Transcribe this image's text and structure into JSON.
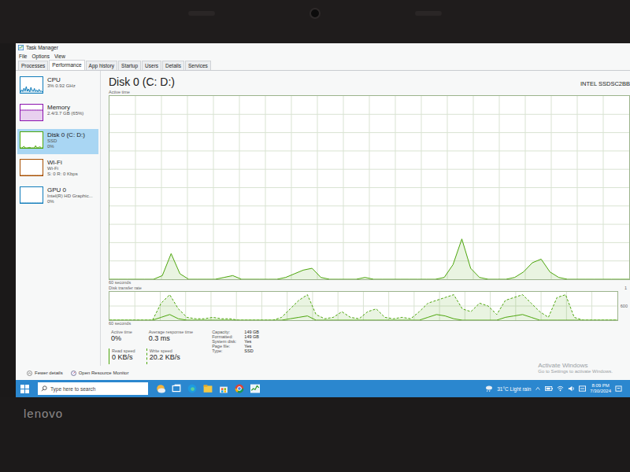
{
  "bezel": {
    "brand": "lenovo"
  },
  "window": {
    "title": "Task Manager"
  },
  "menu": [
    "File",
    "Options",
    "View"
  ],
  "tabs": [
    {
      "label": "Processes",
      "selected": false
    },
    {
      "label": "Performance",
      "selected": true
    },
    {
      "label": "App history",
      "selected": false
    },
    {
      "label": "Startup",
      "selected": false
    },
    {
      "label": "Users",
      "selected": false
    },
    {
      "label": "Details",
      "selected": false
    },
    {
      "label": "Services",
      "selected": false
    }
  ],
  "sidebar": {
    "items": [
      {
        "name": "CPU",
        "lines": [
          "3% 0.92 GHz"
        ],
        "selected": false,
        "color": "#117dbb",
        "graph": [
          5,
          20,
          8,
          30,
          12,
          40,
          10,
          25,
          6,
          35,
          15,
          10,
          28,
          8,
          18,
          6,
          22,
          9,
          12,
          5
        ]
      },
      {
        "name": "Memory",
        "lines": [
          "2.4/3.7 GB (65%)"
        ],
        "selected": false,
        "color": "#8b12ae",
        "graph": [
          65,
          65,
          65,
          65,
          65,
          65,
          65,
          65,
          65,
          65,
          65,
          65,
          65,
          65,
          65,
          65,
          65,
          65,
          65,
          65
        ]
      },
      {
        "name": "Disk 0 (C: D:)",
        "lines": [
          "SSD",
          "0%"
        ],
        "selected": true,
        "color": "#4da60c",
        "graph": [
          0,
          0,
          4,
          10,
          0,
          0,
          0,
          2,
          3,
          0,
          0,
          0,
          0,
          14,
          2,
          0,
          5,
          6,
          0,
          0
        ]
      },
      {
        "name": "Wi-Fi",
        "lines": [
          "Wi-Fi",
          "S: 0 R: 0 Kbps"
        ],
        "selected": false,
        "color": "#a74f01",
        "graph": [
          0,
          0,
          0,
          0,
          0,
          0,
          0,
          0,
          0,
          0,
          0,
          0,
          0,
          0,
          0,
          0,
          0,
          0,
          0,
          2
        ]
      },
      {
        "name": "GPU 0",
        "lines": [
          "Intel(R) HD Graphic...",
          "0%"
        ],
        "selected": false,
        "color": "#117dbb",
        "graph": [
          0,
          0,
          0,
          0,
          0,
          0,
          0,
          0,
          0,
          0,
          0,
          0,
          0,
          0,
          0,
          0,
          0,
          0,
          0,
          0
        ]
      }
    ]
  },
  "detail": {
    "title": "Disk 0 (C: D:)",
    "model": "INTEL SSDSC2BB",
    "active_chart": {
      "label": "Active time",
      "bottom_left": "60 seconds",
      "values": [
        0,
        0,
        0,
        0,
        0,
        0,
        2,
        14,
        3,
        0,
        0,
        0,
        0,
        1,
        2,
        0,
        0,
        0,
        0,
        0,
        1,
        3,
        5,
        6,
        1,
        0,
        0,
        0,
        0,
        1,
        0,
        0,
        0,
        0,
        0,
        0,
        0,
        0,
        1,
        8,
        22,
        6,
        1,
        0,
        0,
        0,
        1,
        4,
        9,
        11,
        4,
        1,
        0,
        0,
        0,
        0,
        0,
        0,
        0,
        0
      ]
    },
    "transfer_chart": {
      "label": "Disk transfer rate",
      "top_right": "1",
      "mid_right": "600",
      "bottom_left": "60 seconds",
      "write": [
        0,
        0,
        0,
        0,
        0,
        0,
        60,
        90,
        40,
        10,
        5,
        5,
        10,
        5,
        5,
        0,
        0,
        0,
        0,
        0,
        10,
        40,
        70,
        90,
        20,
        5,
        10,
        30,
        10,
        5,
        30,
        40,
        10,
        5,
        10,
        5,
        30,
        60,
        70,
        80,
        90,
        40,
        30,
        60,
        50,
        20,
        70,
        80,
        90,
        60,
        30,
        10,
        80,
        90,
        10,
        0,
        0,
        0,
        0,
        0
      ],
      "read": [
        0,
        0,
        0,
        0,
        0,
        0,
        10,
        20,
        5,
        0,
        0,
        0,
        0,
        0,
        0,
        0,
        0,
        0,
        0,
        0,
        0,
        5,
        10,
        15,
        0,
        0,
        0,
        0,
        0,
        0,
        0,
        0,
        0,
        0,
        0,
        0,
        0,
        10,
        20,
        15,
        5,
        0,
        0,
        0,
        0,
        0,
        10,
        15,
        20,
        10,
        0,
        0,
        0,
        0,
        0,
        0,
        0,
        0,
        0,
        0
      ]
    },
    "stats": [
      {
        "label": "Active time",
        "value": "0%",
        "kind": "plain"
      },
      {
        "label": "Average response time",
        "value": "0.3 ms",
        "kind": "plain"
      },
      {
        "label": "Read speed",
        "value": "0 KB/s",
        "kind": "solid"
      },
      {
        "label": "Write speed",
        "value": "20.2 KB/s",
        "kind": "dashed"
      }
    ],
    "properties": [
      {
        "label": "Capacity:",
        "value": "149 GB"
      },
      {
        "label": "Formatted:",
        "value": "149 GB"
      },
      {
        "label": "System disk:",
        "value": "Yes"
      },
      {
        "label": "Page file:",
        "value": "Yes"
      },
      {
        "label": "Type:",
        "value": "SSD"
      }
    ]
  },
  "footer": {
    "fewer": "Fewer details",
    "resource": "Open Resource Monitor"
  },
  "watermark": {
    "title": "Activate Windows",
    "body": "Go to Settings to activate Windows."
  },
  "taskbar": {
    "search": "Type here to search",
    "weather": "31°C  Light rain",
    "time": "8:09 PM",
    "date": "7/30/2024"
  }
}
